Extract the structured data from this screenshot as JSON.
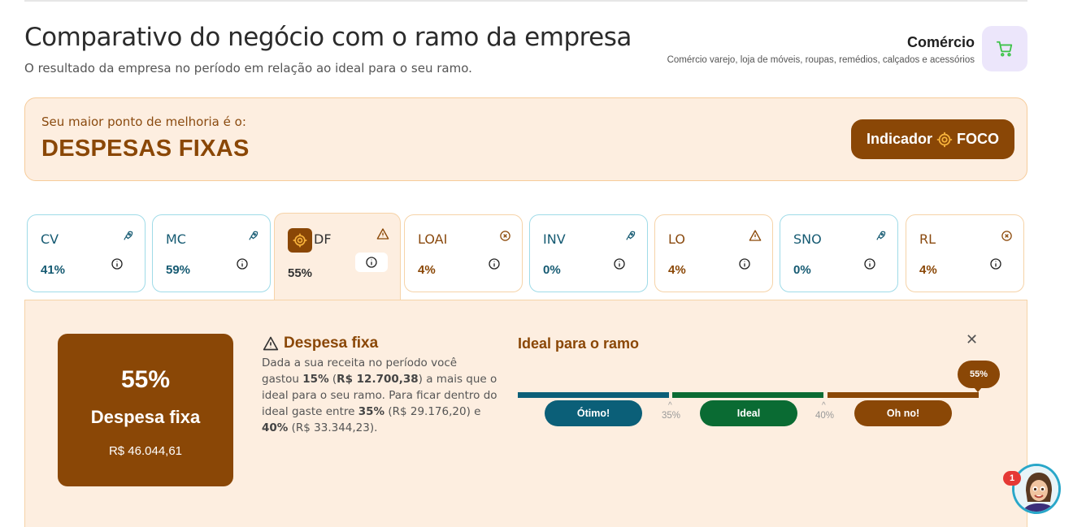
{
  "header": {
    "title": "Comparativo do negócio com o ramo da empresa",
    "subtitle": "O resultado da empresa no período em relação ao ideal para o seu ramo."
  },
  "branch": {
    "name": "Comércio",
    "description": "Comércio varejo, loja de móveis, roupas, remédios, calçados e acessórios",
    "icon": "shopping-cart-icon"
  },
  "focus": {
    "label": "Seu maior ponto de melhoria é o:",
    "value": "DESPESAS FIXAS",
    "button_left": "Indicador",
    "button_right": "FOCO"
  },
  "tabs": [
    {
      "abbr": "CV",
      "pct": "41%",
      "status": "rocket-icon",
      "theme": "blue"
    },
    {
      "abbr": "MC",
      "pct": "59%",
      "status": "rocket-icon",
      "theme": "blue"
    },
    {
      "abbr": "DF",
      "pct": "55%",
      "status": "warning-icon",
      "theme": "orange",
      "active": true
    },
    {
      "abbr": "LOAI",
      "pct": "4%",
      "status": "error-circle-icon",
      "theme": "orange"
    },
    {
      "abbr": "INV",
      "pct": "0%",
      "status": "rocket-icon",
      "theme": "blue"
    },
    {
      "abbr": "LO",
      "pct": "4%",
      "status": "warning-icon",
      "theme": "orange"
    },
    {
      "abbr": "SNO",
      "pct": "0%",
      "status": "rocket-icon",
      "theme": "blue"
    },
    {
      "abbr": "RL",
      "pct": "4%",
      "status": "error-circle-icon",
      "theme": "orange"
    }
  ],
  "detail": {
    "pct": "55%",
    "name": "Despesa fixa",
    "amount": "R$ 46.044,61",
    "desc_title": "Despesa fixa",
    "desc": {
      "p1": "Dada a sua receita no período você gastou ",
      "b1": "15%",
      "p2": " (",
      "b2": "R$ 12.700,38",
      "p3": ") a mais que o ideal para o seu ramo. Para ficar dentro do ideal gaste entre ",
      "b3": "35%",
      "p4": " (R$ 29.176,20) e ",
      "b4": "40%",
      "p5": " (R$ 33.344,23)."
    }
  },
  "ideal": {
    "title": "Ideal para o ramo",
    "labels": [
      "Ótimo!",
      "Ideal",
      "Oh no!"
    ],
    "ticks": [
      "35%",
      "40%"
    ],
    "current": "55%",
    "current_value": 55,
    "colors": {
      "otimo": "#0b5f78",
      "ideal": "#0a6b33",
      "ohno": "#8a4706"
    }
  },
  "notification": {
    "count": "1"
  },
  "colors": {
    "accent": "#8a4706",
    "banner_bg": "#fdeee0",
    "blue": "#155a72"
  }
}
